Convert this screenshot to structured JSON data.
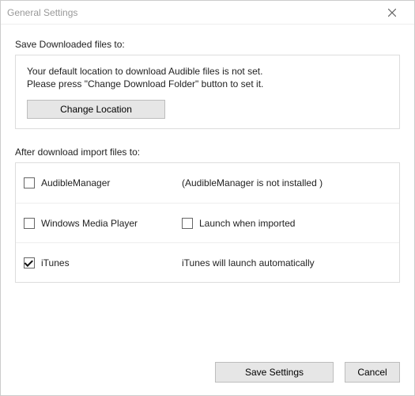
{
  "window": {
    "title": "General Settings"
  },
  "download": {
    "section_label": "Save Downloaded files to:",
    "msg_line1": "Your default location to download Audible files is not set.",
    "msg_line2": "Please press \"Change Download Folder\" button to set it.",
    "change_btn": "Change Location"
  },
  "import": {
    "section_label": "After download import files to:",
    "rows": [
      {
        "label": "AudibleManager",
        "checked": false,
        "note": "(AudibleManager is not installed )"
      },
      {
        "label": "Windows Media Player",
        "checked": false,
        "secondary_checkbox": {
          "label": "Launch when imported",
          "checked": false
        }
      },
      {
        "label": "iTunes",
        "checked": true,
        "note": "iTunes will launch automatically"
      }
    ]
  },
  "footer": {
    "save": "Save Settings",
    "cancel": "Cancel"
  }
}
